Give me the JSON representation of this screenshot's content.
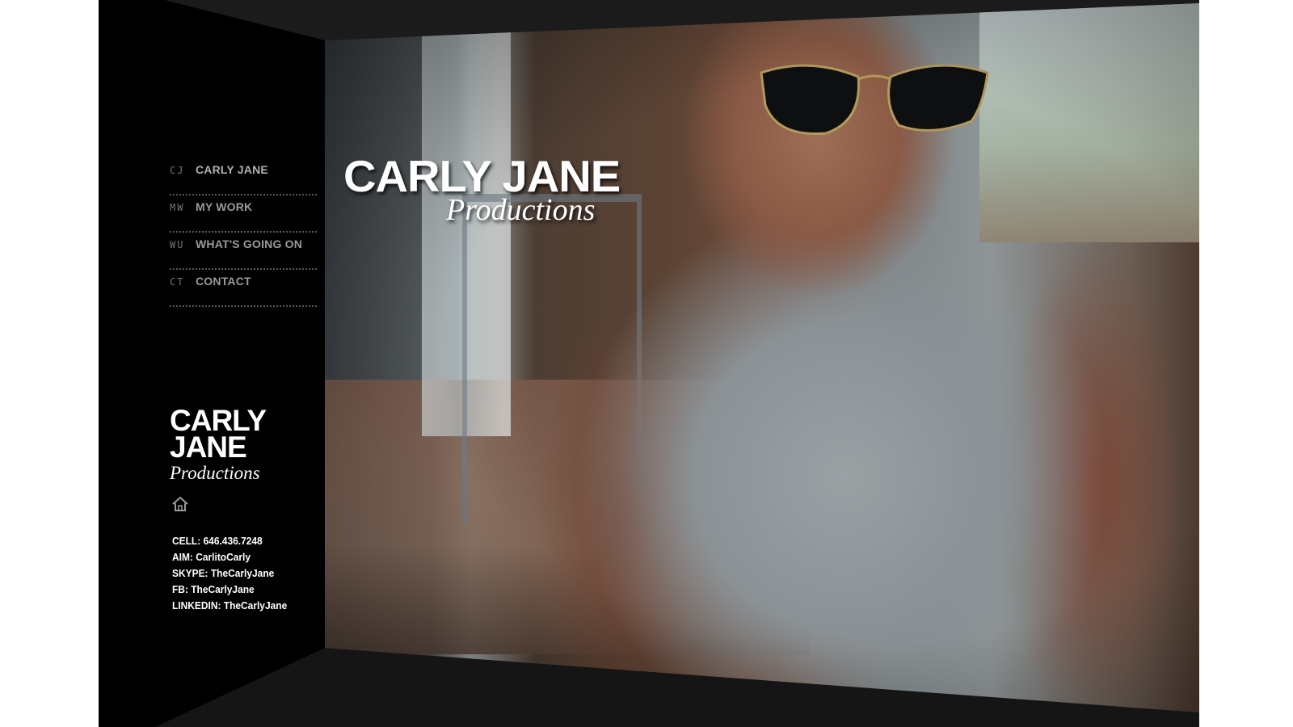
{
  "colors": {
    "background": "#000000",
    "text": "#ffffff",
    "nav_text": "#9a9a9a",
    "nav_divider": "#5a5a5a"
  },
  "hero": {
    "title": "CARLY JANE",
    "subtitle": "Productions"
  },
  "nav": {
    "items": [
      {
        "abbr": "CJ",
        "label": "CARLY JANE"
      },
      {
        "abbr": "MW",
        "label": "MY WORK"
      },
      {
        "abbr": "WU",
        "label": "WHAT'S GOING ON"
      },
      {
        "abbr": "CT",
        "label": "CONTACT"
      }
    ]
  },
  "sidebar": {
    "logo_title": "CARLY JANE",
    "logo_subtitle": "Productions",
    "home_icon": "home-icon"
  },
  "contact": {
    "cell": "CELL: 646.436.7248",
    "aim": "AIM: CarlitoCarly",
    "skype": "SKYPE: TheCarlyJane",
    "fb": "FB: TheCarlyJane",
    "linkedin": "LINKEDIN: TheCarlyJane"
  }
}
